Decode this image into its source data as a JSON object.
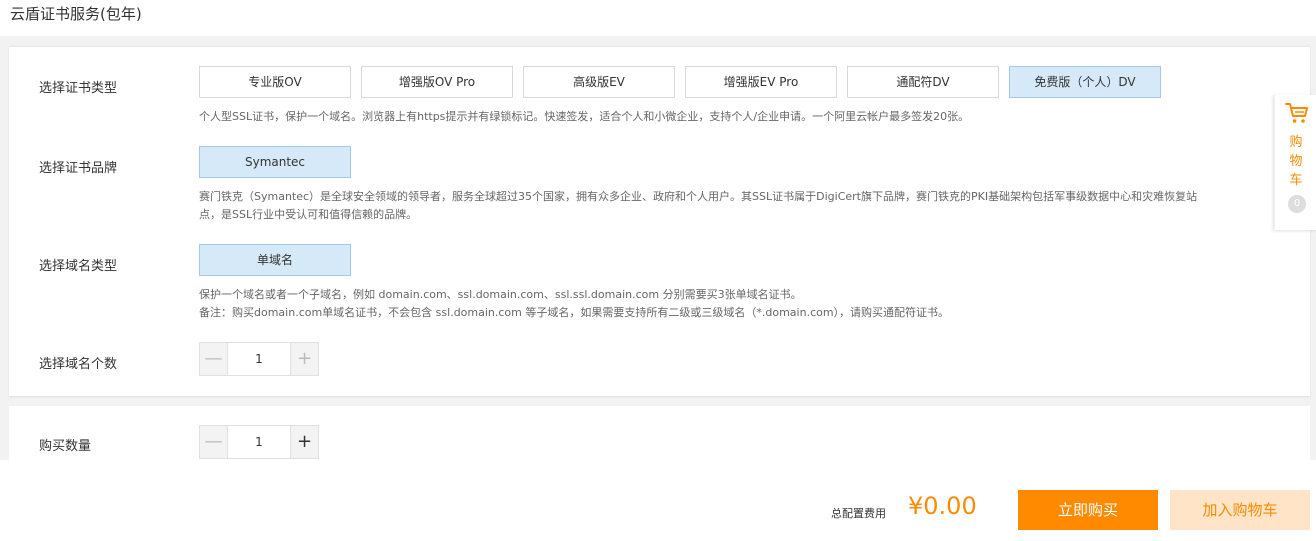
{
  "page": {
    "title": "云盾证书服务(包年)"
  },
  "cert_type": {
    "label": "选择证书类型",
    "options": [
      {
        "label": "专业版OV",
        "selected": false
      },
      {
        "label": "增强版OV Pro",
        "selected": false
      },
      {
        "label": "高级版EV",
        "selected": false
      },
      {
        "label": "增强版EV Pro",
        "selected": false
      },
      {
        "label": "通配符DV",
        "selected": false
      },
      {
        "label": "免费版（个人）DV",
        "selected": true
      }
    ],
    "description": "个人型SSL证书，保护一个域名。浏览器上有https提示并有绿锁标记。快速签发，适合个人和小微企业，支持个人/企业申请。一个阿里云帐户最多签发20张。"
  },
  "brand": {
    "label": "选择证书品牌",
    "options": [
      {
        "label": "Symantec",
        "selected": true
      }
    ],
    "description_line1": "赛门铁克（Symantec）是全球安全领域的领导者，服务全球超过35个国家，拥有众多企业、政府和个人用户。其SSL证书属于DigiCert旗下品牌，赛门铁克的PKI基础架构包括军事级数据中心和灾难恢复站",
    "description_line2": "点，是SSL行业中受认可和值得信赖的品牌。"
  },
  "domain_type": {
    "label": "选择域名类型",
    "options": [
      {
        "label": "单域名",
        "selected": true
      }
    ],
    "description_line1": "保护一个域名或者一个子域名，例如 domain.com、ssl.domain.com、ssl.ssl.domain.com 分别需要买3张单域名证书。",
    "description_line2": "备注：购买domain.com单域名证书，不会包含 ssl.domain.com 等子域名，如果需要支持所有二级或三级域名（*.domain.com），请购买通配符证书。"
  },
  "domain_count": {
    "label": "选择域名个数",
    "value": "1",
    "minus": "—",
    "plus": "+"
  },
  "purchase_qty": {
    "label": "购买数量",
    "value": "1",
    "minus": "—",
    "plus": "+"
  },
  "side_cart": {
    "label_chars": [
      "购",
      "物",
      "车"
    ],
    "count": "0",
    "icon": "shopping-cart-icon"
  },
  "footer": {
    "total_label": "总配置费用",
    "total_price": "¥0.00",
    "buy_now": "立即购买",
    "add_to_cart": "加入购物车"
  },
  "colors": {
    "accent": "#ff8a00",
    "selected_bg": "#d6e9f8",
    "selected_border": "#a3c8ea"
  }
}
